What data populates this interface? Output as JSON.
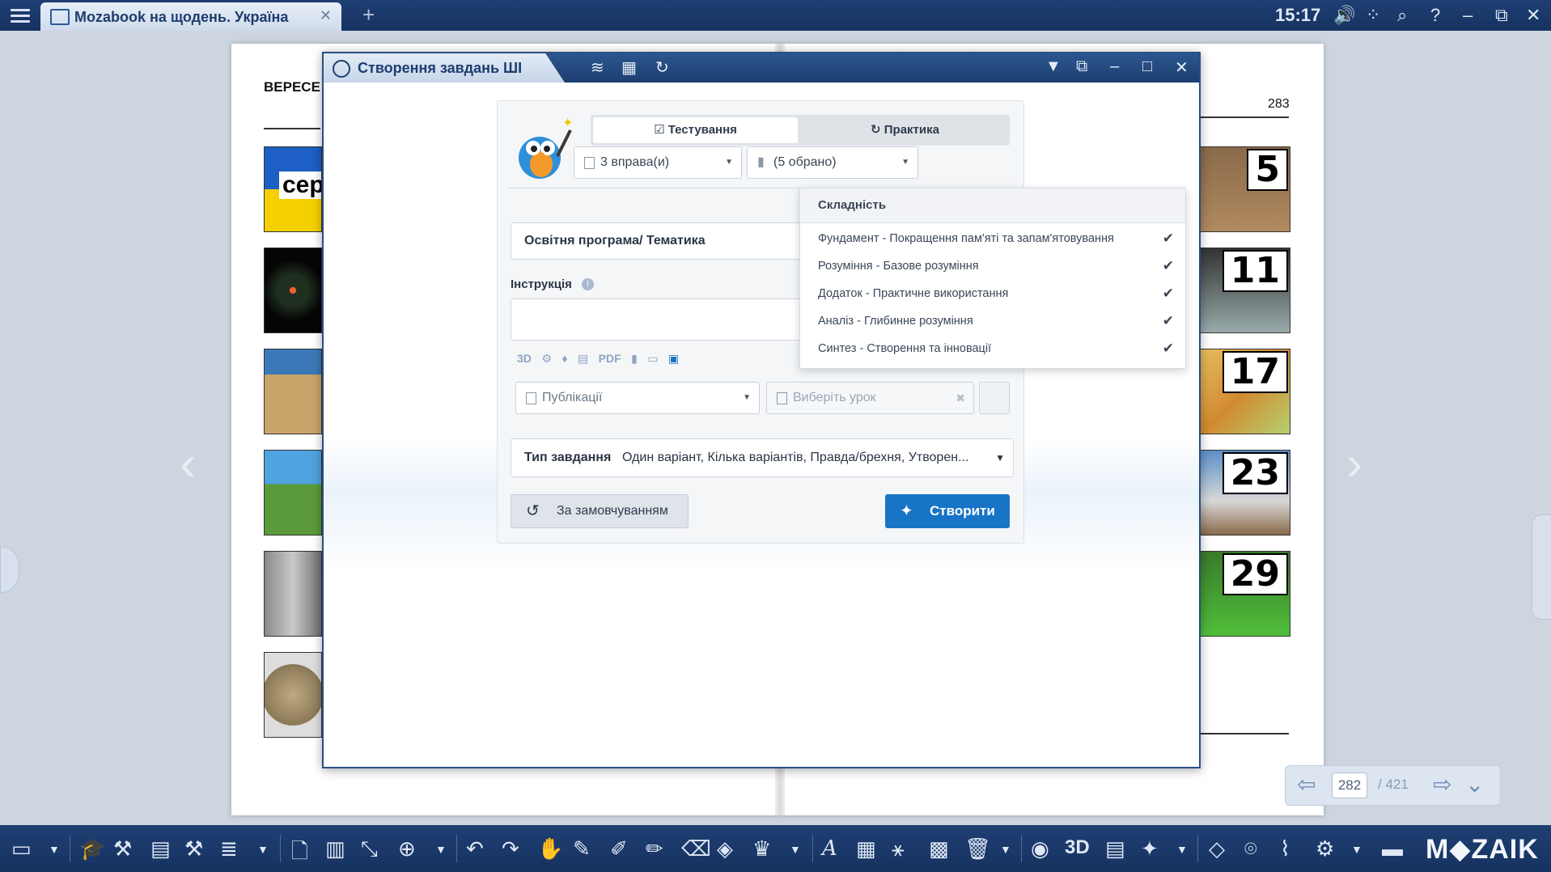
{
  "topbar": {
    "tab_title": "Mozabook на щодень. Україна",
    "tab_close": "✕",
    "add_tab": "+",
    "time": "15:17",
    "icons": [
      "volume-icon",
      "apps-icon",
      "search-icon",
      "help-icon",
      "minimize-icon",
      "restore-icon",
      "close-icon"
    ]
  },
  "book": {
    "left_title": "ВЕРЕСЕ",
    "thumb_text": "сер",
    "page_number": "283",
    "right_numbers": [
      "5",
      "11",
      "17",
      "23",
      "29"
    ],
    "pager": {
      "current": "282",
      "total": "/ 421"
    }
  },
  "dialog": {
    "title": "Створення завдань ШІ",
    "tabs": {
      "testing": "Тестування",
      "practice": "Практика"
    },
    "exercises_value": "3 вправа(и)",
    "difficulty_value": "(5 обрано)",
    "program_label": "Освітня програма/ Тематика",
    "instruction_label": "Інструкція",
    "info_glyph": "i",
    "media_labels": [
      "3D",
      "⚙",
      "♦",
      "▤",
      "PDF",
      "▮",
      "▭",
      "▣"
    ],
    "publications_placeholder": "Публікації",
    "lesson_placeholder": "Виберіть урок",
    "lesson_clear": "✖",
    "task_type_label": "Тип завдання",
    "task_type_value": "Один варіант, Кілька варіантів, Правда/брехня, Утворен...",
    "reset_label": "За замовчуванням",
    "create_label": "Створити"
  },
  "difficulty_menu": {
    "header": "Складність",
    "items": [
      {
        "label": "Фундамент - Покращення пам'яті та запам'ятовування",
        "checked": true
      },
      {
        "label": "Розуміння - Базове розуміння",
        "checked": true
      },
      {
        "label": "Додаток - Практичне використання",
        "checked": true
      },
      {
        "label": "Аналіз - Глибинне розуміння",
        "checked": true
      },
      {
        "label": "Синтез - Створення та інновації",
        "checked": true
      }
    ],
    "check_glyph": "✔"
  },
  "toolbar": {
    "brand": "M◆ZAIK"
  },
  "colors": {
    "title_bar": "#1c3e70",
    "accent_button": "#1874c6",
    "panel_bg": "#f4f6f8"
  }
}
